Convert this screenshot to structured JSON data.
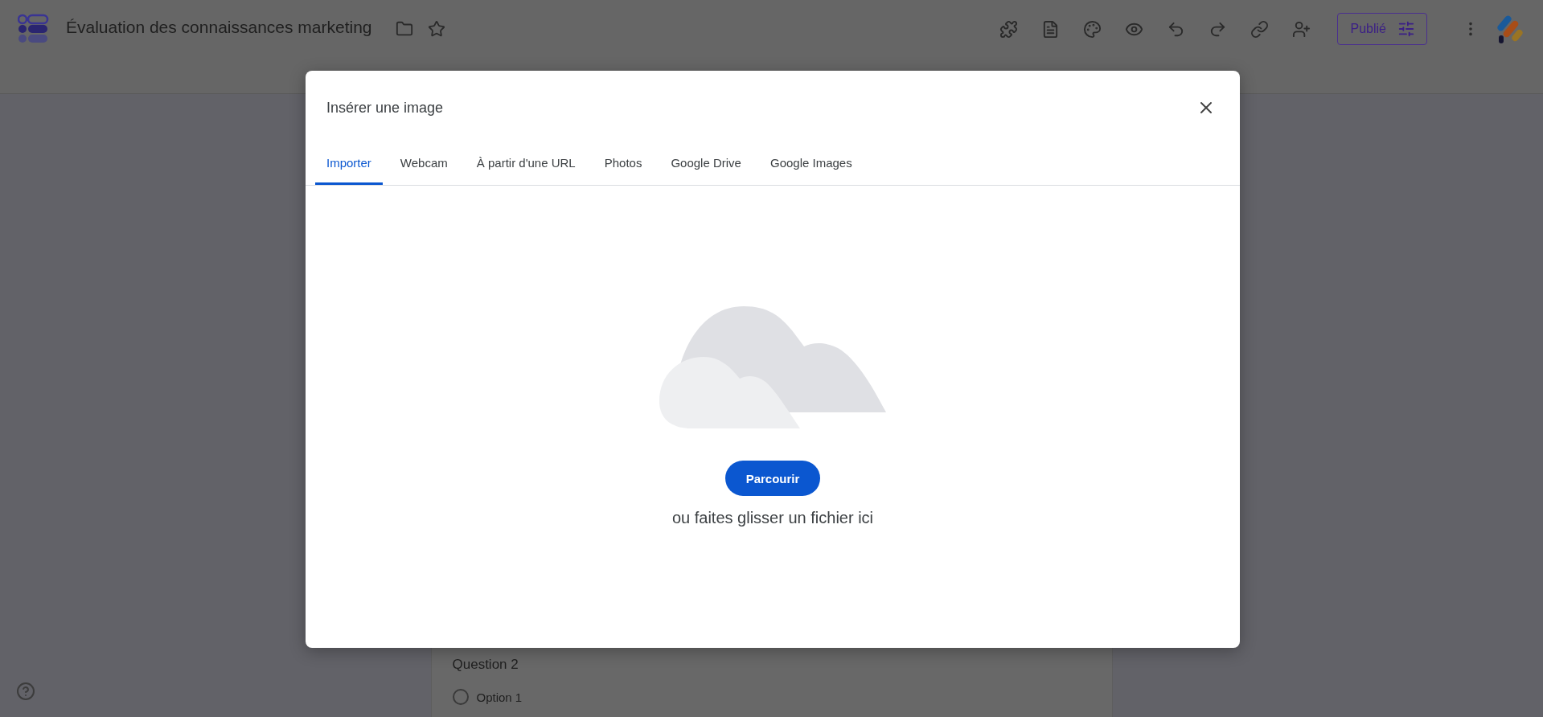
{
  "header": {
    "title": "Évaluation des connaissances marketing",
    "publish_button": "Publié"
  },
  "form": {
    "question": "Question 2",
    "options": [
      {
        "label": "Option 1",
        "selected": false
      }
    ]
  },
  "dialog": {
    "title": "Insérer une image",
    "tabs": [
      {
        "label": "Importer",
        "selected": true
      },
      {
        "label": "Webcam",
        "selected": false
      },
      {
        "label": "À partir d'une URL",
        "selected": false
      },
      {
        "label": "Photos",
        "selected": false
      },
      {
        "label": "Google Drive",
        "selected": false
      },
      {
        "label": "Google Images",
        "selected": false
      }
    ],
    "browse_button": "Parcourir",
    "drop_hint": "ou faites glisser un fichier ici"
  }
}
